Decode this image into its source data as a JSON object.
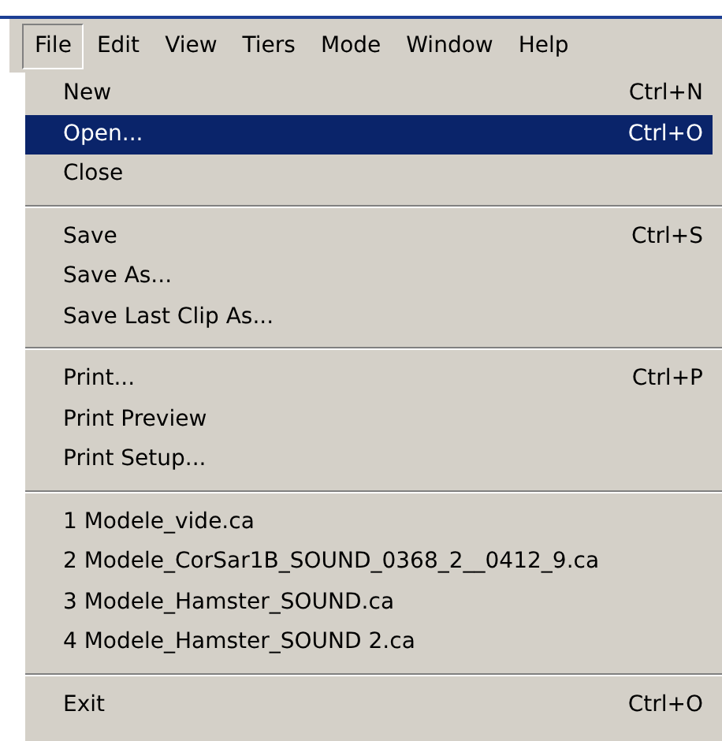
{
  "menubar": [
    {
      "label": "File",
      "selected": true
    },
    {
      "label": "Edit",
      "selected": false
    },
    {
      "label": "View",
      "selected": false
    },
    {
      "label": "Tiers",
      "selected": false
    },
    {
      "label": "Mode",
      "selected": false
    },
    {
      "label": "Window",
      "selected": false
    },
    {
      "label": "Help",
      "selected": false
    }
  ],
  "menu": {
    "groups": [
      [
        {
          "label": "New",
          "shortcut": "Ctrl+N",
          "selected": false
        },
        {
          "label": "Open...",
          "shortcut": "Ctrl+O",
          "selected": true
        },
        {
          "label": "Close",
          "selected": false
        }
      ],
      [
        {
          "label": "Save",
          "shortcut": "Ctrl+S",
          "selected": false
        },
        {
          "label": "Save As...",
          "selected": false
        },
        {
          "label": "Save Last Clip As...",
          "selected": false
        }
      ],
      [
        {
          "label": "Print...",
          "shortcut": "Ctrl+P",
          "selected": false
        },
        {
          "label": "Print Preview",
          "selected": false
        },
        {
          "label": "Print Setup...",
          "selected": false
        }
      ],
      [
        {
          "label": "1 Modele_vide.ca",
          "selected": false
        },
        {
          "label": "2 Modele_CorSar1B_SOUND_0368_2__0412_9.ca",
          "selected": false
        },
        {
          "label": "3 Modele_Hamster_SOUND.ca",
          "selected": false
        },
        {
          "label": "4 Modele_Hamster_SOUND 2.ca",
          "selected": false
        }
      ],
      [
        {
          "label": "Exit",
          "shortcut": "Ctrl+O",
          "selected": false
        }
      ]
    ]
  }
}
